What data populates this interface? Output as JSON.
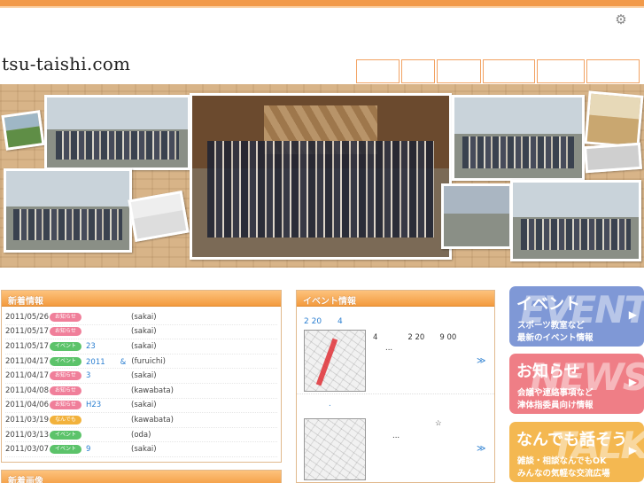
{
  "site": {
    "logo": "tsu-taishi.com"
  },
  "header": {
    "gear_icon": "gear-icon"
  },
  "nav": {
    "button_count_visible": 6
  },
  "news": {
    "title": "新着情報",
    "items": [
      {
        "date": "2011/05/26",
        "badge": "お知らせ",
        "badge_color": "#f07f9a",
        "link": "",
        "author": "(sakai)"
      },
      {
        "date": "2011/05/17",
        "badge": "お知らせ",
        "badge_color": "#f07f9a",
        "link": "",
        "author": "(sakai)"
      },
      {
        "date": "2011/05/17",
        "badge": "イベント",
        "badge_color": "#5cc36a",
        "link": "23",
        "author": "(sakai)"
      },
      {
        "date": "2011/04/17",
        "badge": "イベント",
        "badge_color": "#5cc36a",
        "link": "2011　　&",
        "author": "(furuichi)"
      },
      {
        "date": "2011/04/17",
        "badge": "お知らせ",
        "badge_color": "#f07f9a",
        "link": "3",
        "author": "(sakai)"
      },
      {
        "date": "2011/04/08",
        "badge": "お知らせ",
        "badge_color": "#f07f9a",
        "link": "",
        "author": "(kawabata)"
      },
      {
        "date": "2011/04/06",
        "badge": "お知らせ",
        "badge_color": "#f07f9a",
        "link": "H23",
        "author": "(sakai)"
      },
      {
        "date": "2011/03/19",
        "badge": "なんでも",
        "badge_color": "#f2b23c",
        "link": "",
        "author": "(kawabata)"
      },
      {
        "date": "2011/03/13",
        "badge": "イベント",
        "badge_color": "#5cc36a",
        "link": "",
        "author": "(oda)"
      },
      {
        "date": "2011/03/07",
        "badge": "イベント",
        "badge_color": "#5cc36a",
        "link": "9",
        "author": "(sakai)"
      }
    ]
  },
  "photos": {
    "title": "新着画像"
  },
  "events": {
    "title": "イベント情報",
    "top_link": "2 20　　4",
    "item1": {
      "line1": "4　　　　2 20　　9 00",
      "line2": "...",
      "more": "≫"
    },
    "item2": {
      "link": ".",
      "star": "☆",
      "line2": "...",
      "more": "≫"
    }
  },
  "side_banners": [
    {
      "title": "イベント",
      "bg_word": "EVENT",
      "line1": "スポーツ教室など",
      "line2": "最新のイベント情報",
      "color": "#7f98d6",
      "arrow": "▶"
    },
    {
      "title": "お知らせ",
      "bg_word": "NEWS",
      "line1": "会議や連絡事項など",
      "line2": "津体指委員向け情報",
      "color": "#ef7e86",
      "arrow": "▶"
    },
    {
      "title": "なんでも話そう",
      "bg_word": "TALK",
      "line1": "雑談・相談なんでもOK",
      "line2": "みんなの気軽な交流広場",
      "color": "#f4b851",
      "arrow": "▶"
    }
  ]
}
